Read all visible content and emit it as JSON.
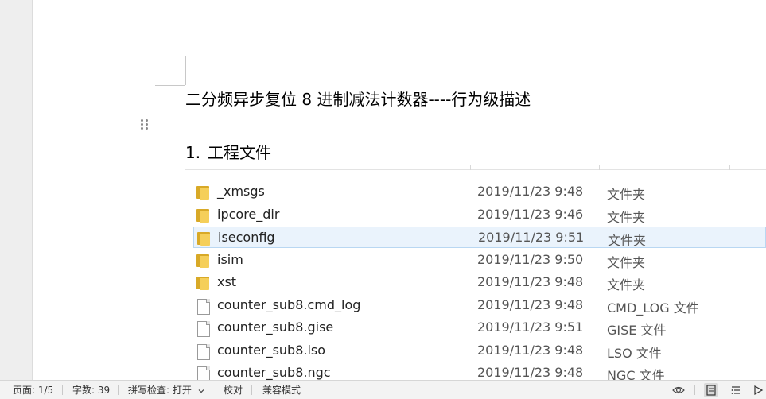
{
  "document": {
    "title": "二分频异步复位 8 进制减法计数器----行为级描述",
    "heading_number": "1.",
    "heading_text": "工程文件"
  },
  "explorer": {
    "files": [
      {
        "name": "_xmsgs",
        "date": "2019/11/23 9:48",
        "type": "文件夹",
        "icon": "folder-icon"
      },
      {
        "name": "ipcore_dir",
        "date": "2019/11/23 9:46",
        "type": "文件夹",
        "icon": "folder-icon"
      },
      {
        "name": "iseconfig",
        "date": "2019/11/23 9:51",
        "type": "文件夹",
        "icon": "folder-icon",
        "selected": true
      },
      {
        "name": "isim",
        "date": "2019/11/23 9:50",
        "type": "文件夹",
        "icon": "folder-icon"
      },
      {
        "name": "xst",
        "date": "2019/11/23 9:48",
        "type": "文件夹",
        "icon": "folder-icon"
      },
      {
        "name": "counter_sub8.cmd_log",
        "date": "2019/11/23 9:48",
        "type": "CMD_LOG 文件",
        "icon": "file-icon"
      },
      {
        "name": "counter_sub8.gise",
        "date": "2019/11/23 9:51",
        "type": "GISE 文件",
        "icon": "file-icon"
      },
      {
        "name": "counter_sub8.lso",
        "date": "2019/11/23 9:48",
        "type": "LSO 文件",
        "icon": "file-icon"
      },
      {
        "name": "counter_sub8.ngc",
        "date": "2019/11/23 9:48",
        "type": "NGC 文件",
        "icon": "file-icon"
      }
    ]
  },
  "statusbar": {
    "page": "页面: 1/5",
    "word_count": "字数: 39",
    "spell_check": "拼写检查: 打开",
    "proofread": "校对",
    "compat_mode": "兼容模式"
  },
  "colors": {
    "folder": "#f5cf5a",
    "selection": "#eaf3fc",
    "statusbar_bg": "#f3f3f3"
  }
}
